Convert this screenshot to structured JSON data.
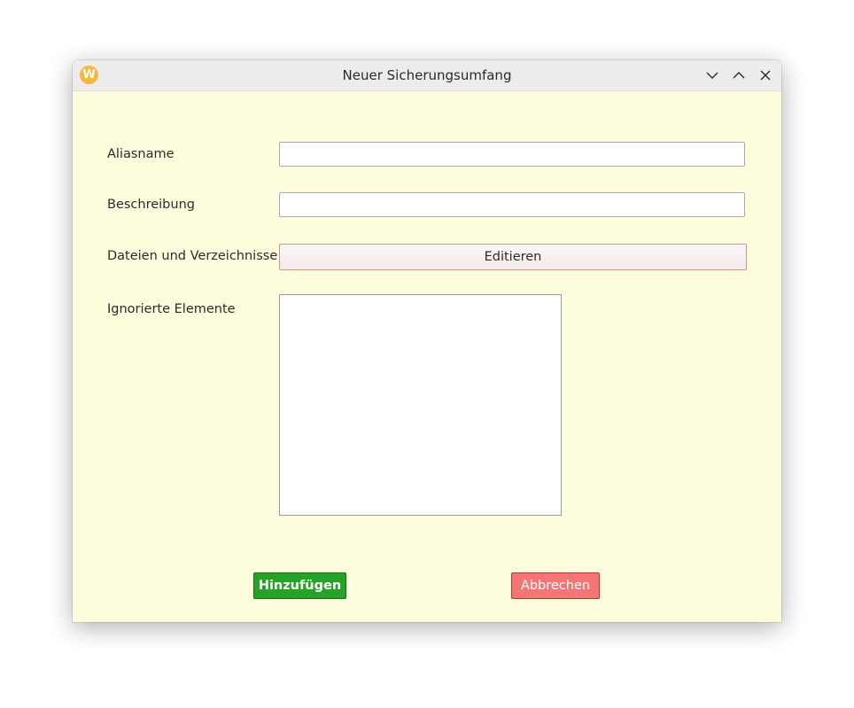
{
  "window": {
    "title": "Neuer Sicherungsumfang",
    "app_icon": "W",
    "controls": {
      "minimize_icon": "chevron-down-icon",
      "maximize_icon": "chevron-up-icon",
      "close_icon": "close-icon"
    }
  },
  "form": {
    "alias_label": "Aliasname",
    "alias_value": "",
    "description_label": "Beschreibung",
    "description_value": "",
    "files_label": "Dateien und Verzeichnisse",
    "edit_button": "Editieren",
    "ignored_label": "Ignorierte Elemente",
    "ignored_items": []
  },
  "actions": {
    "add_label": "Hinzufügen",
    "cancel_label": "Abbrechen"
  },
  "colors": {
    "background": "#fdfcdc",
    "titlebar": "#ececec",
    "add_button": "#27a127",
    "cancel_button": "#f57575",
    "app_icon": "#f5b83d"
  }
}
